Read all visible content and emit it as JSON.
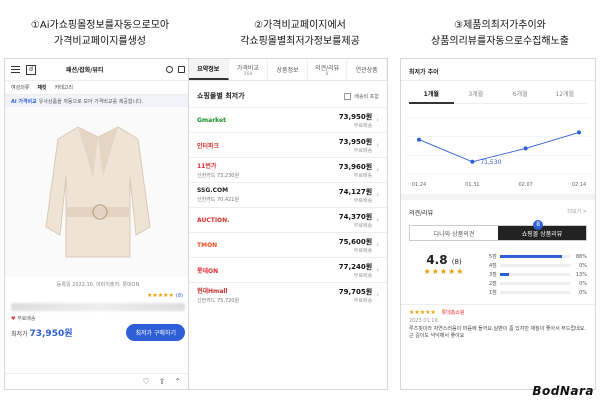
{
  "captions": {
    "c1_line1": "①Ai가쇼핑몰정보를자동으로모아",
    "c1_line2": "가격비교페이지를생성",
    "c2_line1": "②가격비교페이지에서",
    "c2_line2": "각쇼핑몰별최저가정보를제공",
    "c3_line1": "③제품의최저가추이와",
    "c3_line2": "상품의리뷰를자동으로수집해노출"
  },
  "panel1": {
    "logo": "d",
    "title": "패션/잡화/뷰티",
    "filters": [
      "여성의류",
      "재킷",
      "카테고리"
    ],
    "notice_ai": "Ai 가격비교",
    "notice_text": "유사상품을 자동으로 모아 가격비교를 제공합니다.",
    "meta": "등록일 2022.10.    이미지출처: 롯데ON",
    "rating_count": "(8)",
    "ship_text": "무료배송",
    "price_label": "최저가",
    "price": "73,950원",
    "buy_label": "최저가 구매하기"
  },
  "panel2": {
    "tabs": [
      {
        "label": "요약정보",
        "sub": ""
      },
      {
        "label": "가격비교",
        "sub": "268"
      },
      {
        "label": "상품정보",
        "sub": ""
      },
      {
        "label": "의견/리뷰",
        "sub": "8"
      },
      {
        "label": "연관상품",
        "sub": ""
      }
    ],
    "section_title": "쇼핑몰별 최저가",
    "ship_toggle": "배송비 포함",
    "malls": [
      {
        "logo": "Gmarket",
        "color": "#1b8d2b",
        "card": "",
        "price": "73,950원",
        "ship": "무료배송"
      },
      {
        "logo": "인터파크",
        "color": "#d4322c",
        "card": "",
        "price": "73,950원",
        "ship": "무료배송"
      },
      {
        "logo": "11번가",
        "color": "#e0262e",
        "card": "신한카드 73,230원",
        "price": "73,960원",
        "ship": "무료배송"
      },
      {
        "logo": "SSG.COM",
        "color": "#222222",
        "card": "신한카드 70,421원",
        "price": "74,127원",
        "ship": "무료배송"
      },
      {
        "logo": "AUCTION.",
        "color": "#d4322c",
        "card": "",
        "price": "74,370원",
        "ship": "무료배송"
      },
      {
        "logo": "TMON",
        "color": "#ef4d23",
        "card": "",
        "price": "75,600원",
        "ship": "무료배송"
      },
      {
        "logo": "롯데ON",
        "color": "#e0262e",
        "card": "",
        "price": "77,240원",
        "ship": "무료배송"
      },
      {
        "logo": "현대Hmall",
        "color": "#c42b2b",
        "card": "신한카드 75,720원",
        "price": "79,705원",
        "ship": "무료배송"
      }
    ]
  },
  "panel3": {
    "title": "최저가 추이",
    "periods": [
      "1개월",
      "3개월",
      "6개월",
      "12개월"
    ],
    "review_title": "의견/리뷰",
    "review_more": "더보기 >",
    "review_tabs": [
      "다나와 상품의견",
      "쇼핑몰 상품리뷰"
    ],
    "review_badge": "8",
    "score": "4.8",
    "score_count": "(8)",
    "stars": "★★★★★",
    "distribution": [
      {
        "label": "5점",
        "pct": 88,
        "text": "88%"
      },
      {
        "label": "4점",
        "pct": 0,
        "text": "0%"
      },
      {
        "label": "3점",
        "pct": 13,
        "text": "13%"
      },
      {
        "label": "2점",
        "pct": 0,
        "text": "0%"
      },
      {
        "label": "1점",
        "pct": 0,
        "text": "0%"
      }
    ],
    "review_item": {
      "stars": "★★★★★",
      "mall": "롯데홈쇼핑",
      "date": "2023.01.19.",
      "text": "루즈핏이라 자연스러움이 마음에 들어요.실밴이 좀 있지만 재질이 좋아서 부드럽네요.근 길이도 넉넉해서 좋아요"
    }
  },
  "chart_data": {
    "type": "line",
    "title": "최저가 추이",
    "categories": [
      "01.24",
      "01.31",
      "02.07",
      "02.14"
    ],
    "x": [
      "01.24",
      "01.31",
      "02.07",
      "02.14"
    ],
    "values": [
      74300,
      71530,
      73200,
      75200
    ],
    "annotation": "71,530",
    "ylim": [
      70000,
      77000
    ],
    "grid": true,
    "color": "#2f5fd6"
  },
  "watermark": "BodNara"
}
